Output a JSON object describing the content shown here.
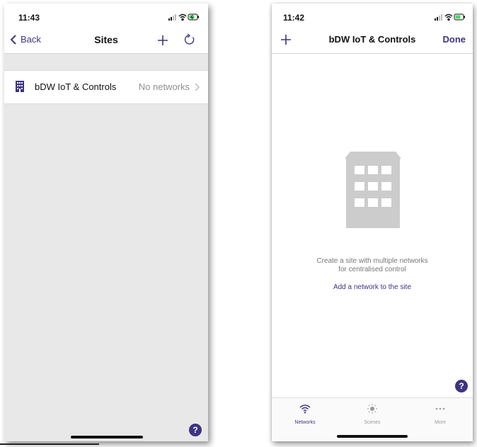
{
  "colors": {
    "accent": "#3d3483",
    "secondary_text": "#8f8f8f",
    "background_grey": "#e8e8e8",
    "illustration_grey": "#cccccc"
  },
  "left_screen": {
    "status_time": "11:43",
    "nav": {
      "back_label": "Back",
      "title": "Sites",
      "add_icon": "plus-icon",
      "refresh_icon": "refresh-icon"
    },
    "sites": [
      {
        "name": "bDW IoT & Controls",
        "status": "No networks",
        "icon": "building-icon"
      }
    ],
    "help_label": "?"
  },
  "right_screen": {
    "status_time": "11:42",
    "nav": {
      "title": "bDW IoT & Controls",
      "done_label": "Done",
      "add_icon": "plus-icon"
    },
    "empty_state": {
      "illustration": "building-icon",
      "line1": "Create a site with multiple networks",
      "line2": "for centralised control",
      "link": "Add a network to the site"
    },
    "help_label": "?",
    "tabs": [
      {
        "label": "Networks",
        "icon": "wifi-icon",
        "active": true
      },
      {
        "label": "Scenes",
        "icon": "sun-icon",
        "active": false
      },
      {
        "label": "More",
        "icon": "ellipsis-icon",
        "active": false
      }
    ]
  }
}
